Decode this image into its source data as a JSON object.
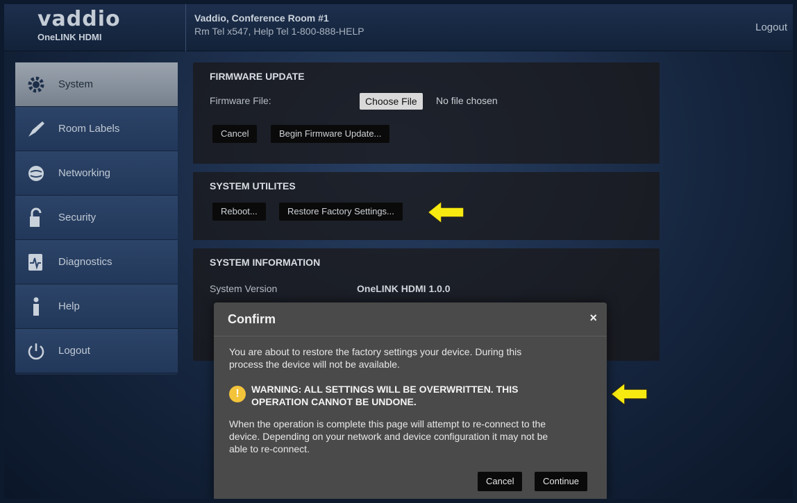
{
  "header": {
    "logo": "vaddio",
    "product": "OneLINK HDMI",
    "room_name": "Vaddio, Conference Room #1",
    "room_tel": "Rm Tel x547, Help Tel 1-800-888-HELP",
    "logout": "Logout"
  },
  "sidebar": {
    "items": [
      {
        "label": "System",
        "icon": "gear-icon"
      },
      {
        "label": "Room Labels",
        "icon": "pen-icon"
      },
      {
        "label": "Networking",
        "icon": "globe-icon"
      },
      {
        "label": "Security",
        "icon": "lock-icon"
      },
      {
        "label": "Diagnostics",
        "icon": "pulse-icon"
      },
      {
        "label": "Help",
        "icon": "info-icon"
      },
      {
        "label": "Logout",
        "icon": "power-icon"
      }
    ]
  },
  "firmware": {
    "title": "FIRMWARE UPDATE",
    "file_label": "Firmware File:",
    "choose_file": "Choose File",
    "no_file": "No file chosen",
    "cancel": "Cancel",
    "begin": "Begin Firmware Update..."
  },
  "utilities": {
    "title": "SYSTEM UTILITES",
    "reboot": "Reboot...",
    "restore": "Restore Factory Settings..."
  },
  "info": {
    "title": "SYSTEM INFORMATION",
    "version_label": "System Version",
    "version_value": "OneLINK HDMI 1.0.0"
  },
  "modal": {
    "title": "Confirm",
    "close": "×",
    "text1_line1": "You are about to restore the factory settings your device. During this",
    "text1_line2": "process the device will not be available.",
    "warning_line1": "WARNING: ALL SETTINGS WILL BE OVERWRITTEN. THIS",
    "warning_line2": "OPERATION CANNOT BE UNDONE.",
    "text2_line1": "When the operation is complete this page will attempt to re-connect to the",
    "text2_line2": "device. Depending on your network and device configuration it may not be",
    "text2_line3": "able to re-connect.",
    "cancel": "Cancel",
    "continue": "Continue"
  },
  "colors": {
    "arrow": "#f7ea10",
    "warning": "#f3c33a"
  }
}
